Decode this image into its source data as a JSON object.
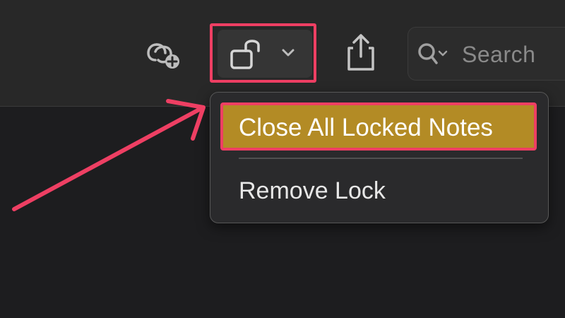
{
  "toolbar": {
    "icons": {
      "collaborate": "people-add-icon",
      "lock": "lock-open-icon",
      "lock_menu": "chevron-down-icon",
      "share": "share-icon",
      "search": "search-icon"
    },
    "search": {
      "placeholder": "Search"
    }
  },
  "lock_menu": {
    "items": [
      {
        "label": "Close All Locked Notes",
        "highlighted": true
      },
      {
        "label": "Remove Lock",
        "highlighted": false
      }
    ]
  },
  "colors": {
    "annotation": "#ee3f63",
    "menu_highlight": "#b38b25"
  }
}
